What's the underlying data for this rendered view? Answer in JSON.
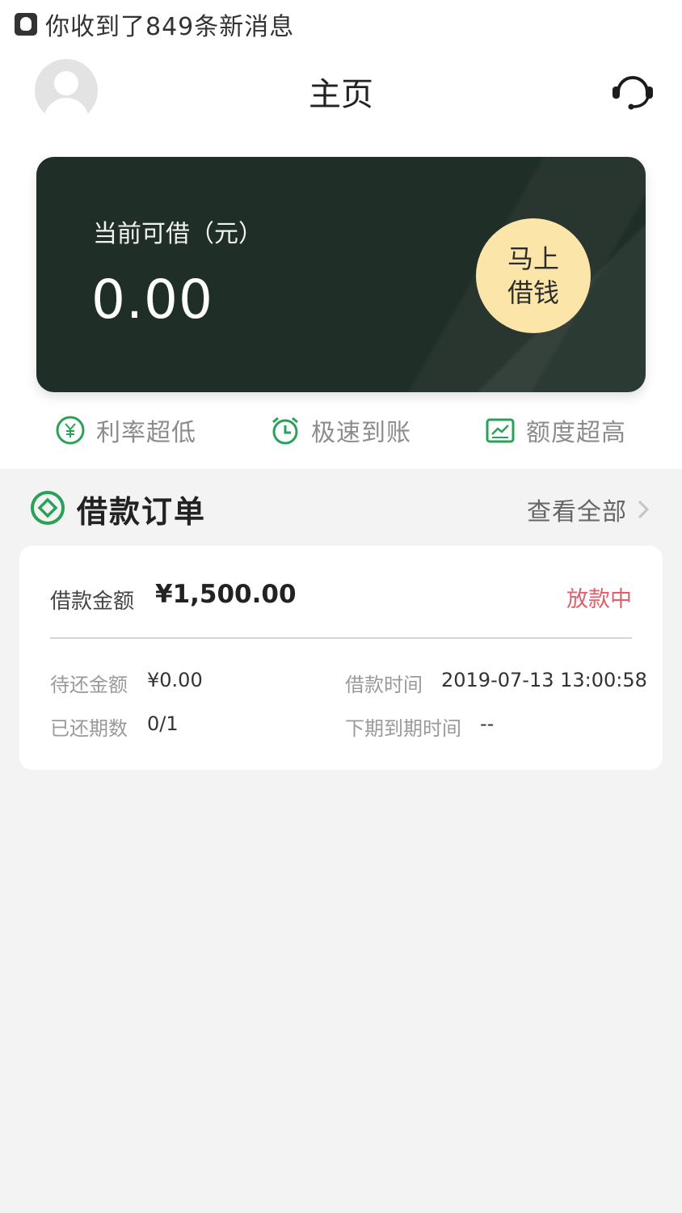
{
  "notification": {
    "text": "你收到了849条新消息",
    "icon": "qq-icon"
  },
  "header": {
    "title": "主页",
    "avatar_icon": "user-icon",
    "support_icon": "headset-icon"
  },
  "loan_card": {
    "label": "当前可借（元）",
    "amount": "0.00",
    "borrow_button": "马上借钱",
    "background_color": "#1f2e27",
    "button_color": "#fbe5a8"
  },
  "features": [
    {
      "label": "利率超低",
      "icon": "yuan-circle-icon"
    },
    {
      "label": "极速到账",
      "icon": "alarm-clock-icon"
    },
    {
      "label": "额度超高",
      "icon": "chart-icon"
    }
  ],
  "orders": {
    "title": "借款订单",
    "view_all": "查看全部",
    "accent_color": "#2aa158",
    "card": {
      "amount_label": "借款金额",
      "amount": "¥1,500.00",
      "status": "放款中",
      "status_color": "#e0606a",
      "details": {
        "pending_label": "待还金额",
        "pending_value": "¥0.00",
        "time_label": "借款时间",
        "time_value": "2019-07-13 13:00:58",
        "periods_label": "已还期数",
        "periods_value": "0/1",
        "due_label": "下期到期时间",
        "due_value": "--"
      }
    }
  }
}
